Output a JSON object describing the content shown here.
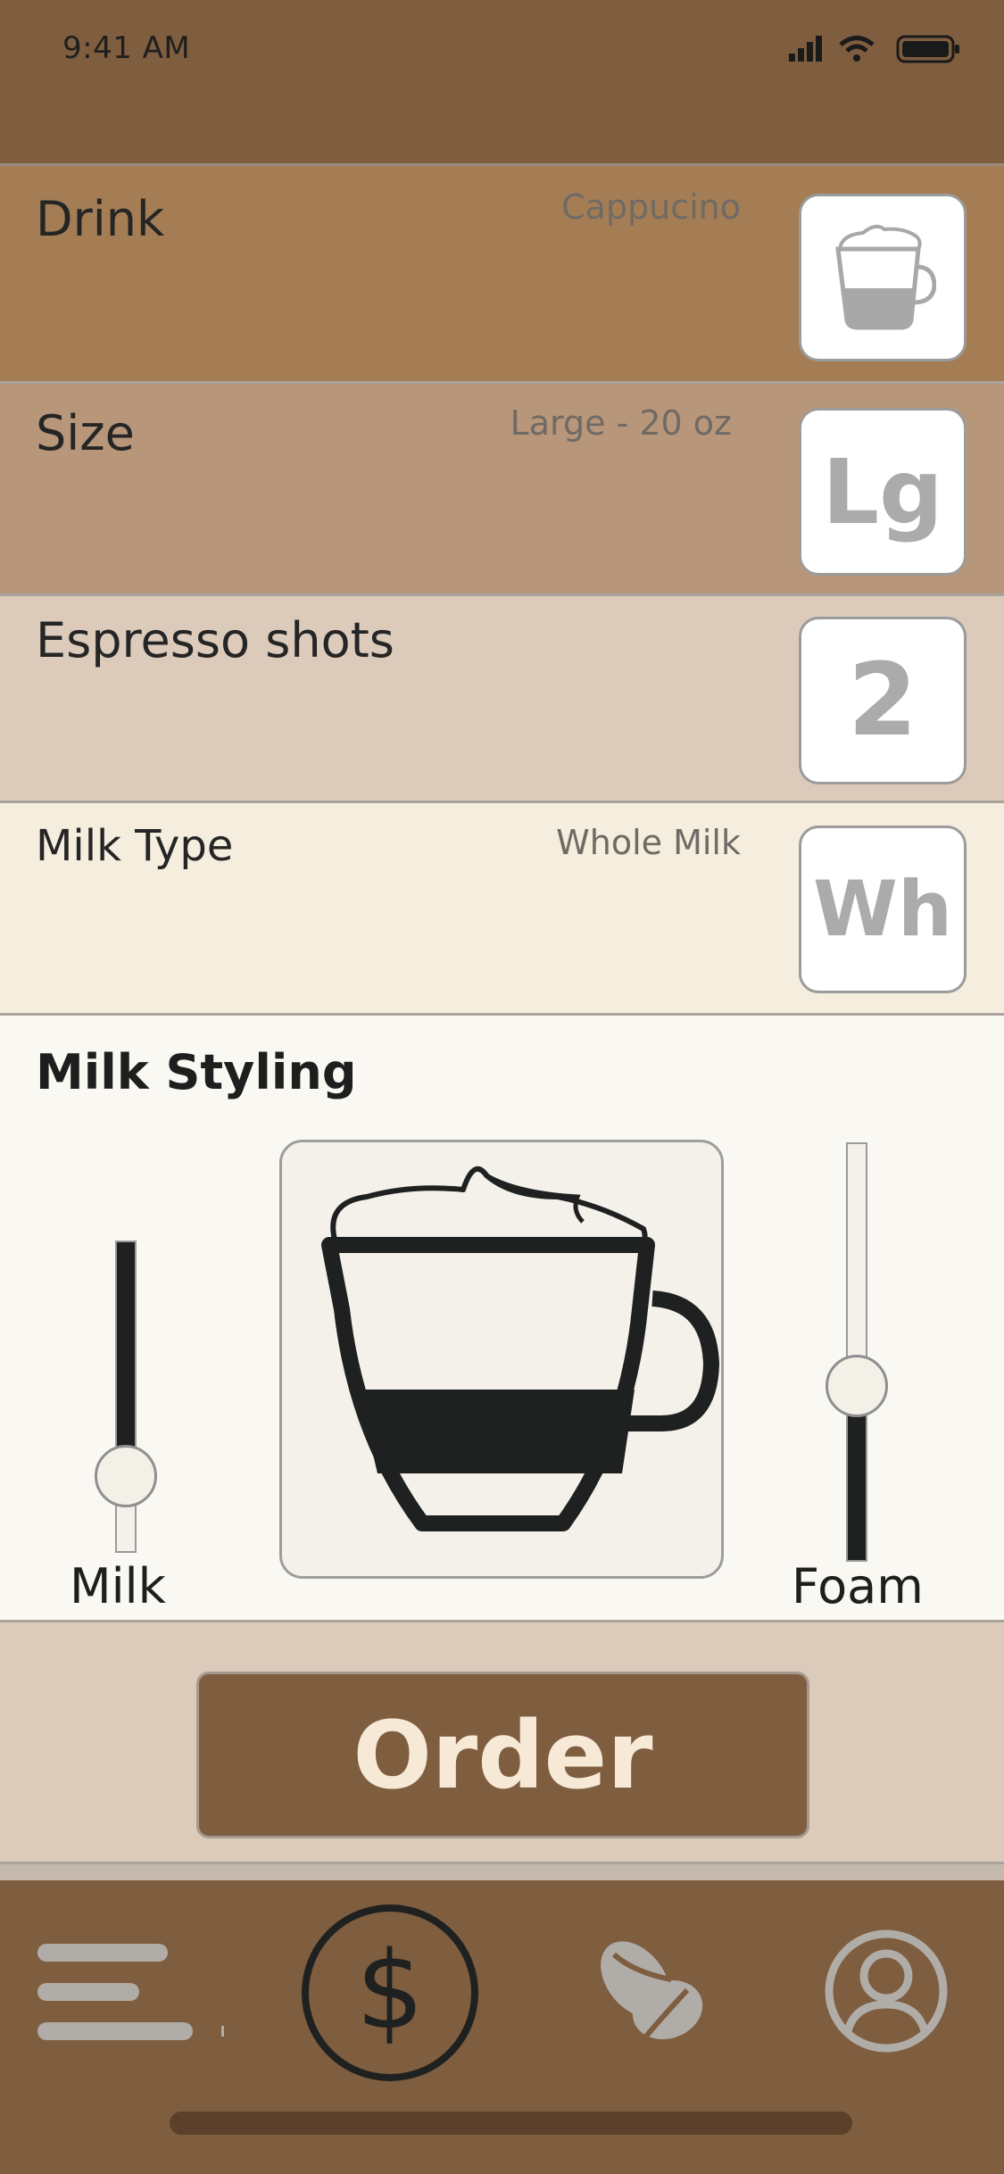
{
  "status_bar": {
    "time": "9:41 AM"
  },
  "rows": {
    "drink": {
      "label": "Drink",
      "value": "Cappucino",
      "tile_icon": "cappuccino-cup-icon",
      "bg": "#a57d54"
    },
    "size": {
      "label": "Size",
      "value": "Large - 20 oz",
      "tile_text": "Lg",
      "bg": "#b8967a"
    },
    "shots": {
      "label": "Espresso shots",
      "tile_text": "2",
      "bg": "#dccbbb"
    },
    "milk_type": {
      "label": "Milk Type",
      "value": "Whole Milk",
      "tile_text": "Wh",
      "bg": "#f5eedf"
    }
  },
  "milk_styling": {
    "title": "Milk Styling",
    "milk_slider": {
      "label": "Milk",
      "level": 0.25
    },
    "foam_slider": {
      "label": "Foam",
      "level": 0.43
    }
  },
  "order_button": {
    "label": "Order"
  },
  "tab_bar": {
    "items": [
      {
        "icon": "menu-icon"
      },
      {
        "icon": "dollar-icon",
        "selected": true
      },
      {
        "icon": "coffee-bean-icon"
      },
      {
        "icon": "profile-icon"
      }
    ]
  },
  "colors": {
    "brand_brown": "#7f5d3f",
    "cream": "#f6ead7",
    "dark": "#1e2120"
  }
}
